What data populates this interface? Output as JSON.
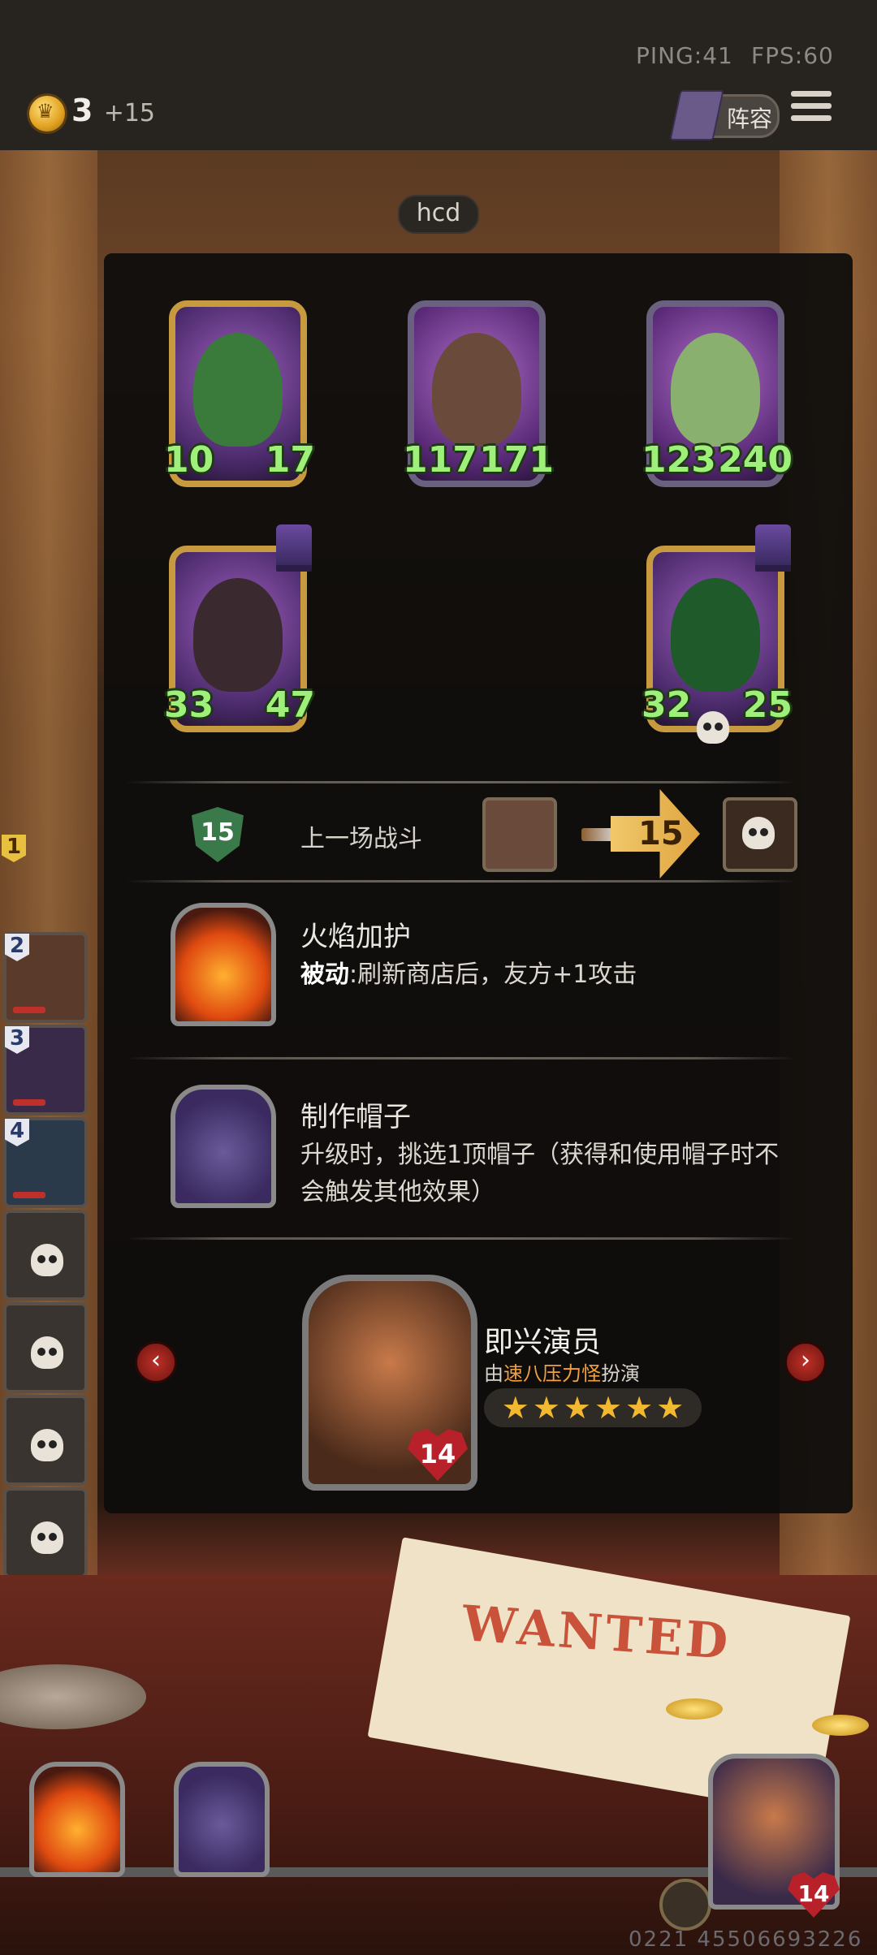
{
  "status": {
    "ping": "PING:41",
    "fps": "FPS:60"
  },
  "resources": {
    "gold": "3",
    "income": "+15"
  },
  "buttons": {
    "lineup": "阵容"
  },
  "opponent": {
    "name": "hcd"
  },
  "board": [
    {
      "atk": "10",
      "hp": "17",
      "frame": "gold",
      "art_color": "#3a7a3a"
    },
    {
      "atk": "117",
      "hp": "171",
      "frame": "silver",
      "art_color": "#6a4a3a"
    },
    {
      "atk": "123",
      "hp": "240",
      "frame": "silver",
      "art_color": "#8ab070"
    },
    {
      "atk": "33",
      "hp": "47",
      "frame": "gold",
      "art_color": "#3a2a30"
    },
    {
      "atk": "32",
      "hp": "25",
      "frame": "gold",
      "art_color": "#1e5a2a"
    }
  ],
  "last_battle": {
    "tier": "15",
    "label": "上一场战斗",
    "damage": "15"
  },
  "skills": [
    {
      "title": "火焰加护",
      "desc_bold": "被动",
      "desc": ":刷新商店后，友方+1攻击"
    },
    {
      "title": "制作帽子",
      "desc": "升级时，挑选1顶帽子（获得和使用帽子时不会触发其他效果）"
    }
  ],
  "hero": {
    "name": "即兴演员",
    "sub_prefix": "由",
    "sub_player": "速八压力怪",
    "sub_suffix": "扮演",
    "stars": [
      "★",
      "★",
      "★",
      "★",
      "★",
      "★"
    ],
    "health": "14"
  },
  "sidebar": [
    {
      "num": "1"
    },
    {
      "num": "2"
    },
    {
      "num": "3"
    },
    {
      "num": "4"
    },
    {
      "num": ""
    },
    {
      "num": ""
    },
    {
      "num": ""
    },
    {
      "num": ""
    }
  ],
  "decor": {
    "wanted": "WANTED"
  },
  "my_hero": {
    "health": "14"
  },
  "footer": {
    "id": "0221 45506693226"
  },
  "colors": {
    "stat_green": "#9ef07a",
    "accent_gold": "#f2b830",
    "health_red": "#b8202a"
  }
}
